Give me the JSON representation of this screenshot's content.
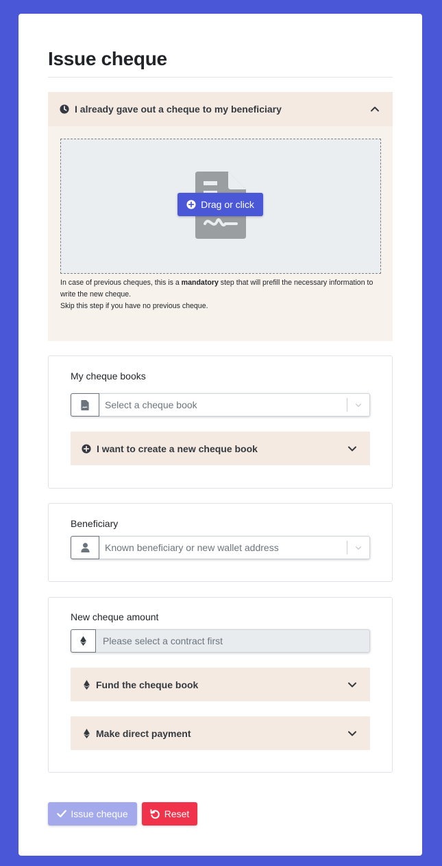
{
  "page": {
    "title": "Issue cheque"
  },
  "previous_cheque": {
    "header": "I already gave out a cheque to my beneficiary",
    "drop_button": "Drag or click",
    "hint_prefix": "In case of previous cheques, this is a ",
    "hint_bold": "mandatory",
    "hint_suffix": " step that will prefill the necessary information to write the new cheque.",
    "hint_skip": "Skip this step if you have no previous cheque."
  },
  "cheque_books": {
    "label": "My cheque books",
    "select_placeholder": "Select a cheque book",
    "create_new": "I want to create a new cheque book"
  },
  "beneficiary": {
    "label": "Beneficiary",
    "select_placeholder": "Known beneficiary or new wallet address"
  },
  "amount": {
    "label": "New cheque amount",
    "input_placeholder": "Please select a contract first",
    "fund": "Fund the cheque book",
    "direct": "Make direct payment"
  },
  "actions": {
    "issue": "Issue cheque",
    "reset": "Reset"
  },
  "colors": {
    "background": "#4a57d6",
    "accordion": "#f5eae1",
    "primary": "#4a57d6",
    "primary_disabled": "#a3a9ea",
    "danger": "#f0324a"
  }
}
